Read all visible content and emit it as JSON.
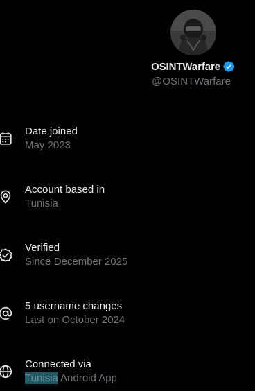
{
  "profile": {
    "display_name": "OSINTWarfare",
    "handle": "@OSINTWarfare",
    "verified_badge_icon": "verified-badge-icon",
    "verified_color": "#1d9bf0"
  },
  "about": {
    "items": [
      {
        "icon": "calendar-icon",
        "label": "Date joined",
        "value": "May 2023"
      },
      {
        "icon": "location-pin-icon",
        "label": "Account based in",
        "value": "Tunisia"
      },
      {
        "icon": "verified-check-icon",
        "label": "Verified",
        "value": "Since December 2025"
      },
      {
        "icon": "at-sign-icon",
        "label": "5 username changes",
        "value": "Last on October 2024"
      },
      {
        "icon": "globe-icon",
        "label": "Connected via",
        "value_highlight": "Tunisia",
        "value_rest": " Android App"
      }
    ]
  },
  "colors": {
    "background": "#000000",
    "primary_text": "#e7e9ea",
    "secondary_text": "#71767b",
    "selection_highlight": "#1c5a66"
  }
}
